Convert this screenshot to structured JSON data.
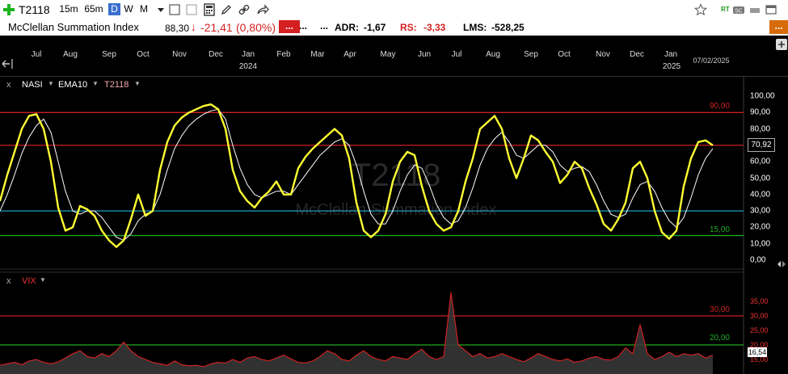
{
  "toolbar": {
    "symbol": "T2118",
    "intervals": [
      "15m",
      "65m",
      "D",
      "W",
      "M"
    ],
    "active_interval": "D",
    "rt_label": "RT",
    "s_label": "S"
  },
  "infobar": {
    "title": "McClellan Summation Index",
    "last": "88,30",
    "change": "-21,41",
    "change_pct": "(0,80%)",
    "dots1": "...",
    "dots2": "...",
    "dots3": "...",
    "adr_label": "ADR:",
    "adr_value": "-1,67",
    "rs_label": "RS:",
    "rs_value": "-3,33",
    "lms_label": "LMS:",
    "lms_value": "-528,25",
    "more_button": "..."
  },
  "timeaxis": {
    "months": [
      "Jul",
      "Aug",
      "Sep",
      "Oct",
      "Nov",
      "Dec",
      "Jan",
      "Feb",
      "Mar",
      "Apr",
      "May",
      "Jun",
      "Jul",
      "Aug",
      "Sep",
      "Oct",
      "Nov",
      "Dec",
      "Jan"
    ],
    "years": [
      "2024",
      "2025"
    ],
    "date_label": "07/02/2025"
  },
  "colors": {
    "main": "#ffff33",
    "ema": "#ffffff",
    "upper": "#cc1f1f",
    "mid": "#1fa0c0",
    "lower": "#22aa22",
    "vix": "#cc2222"
  },
  "chart_data": [
    {
      "type": "line",
      "watermark_symbol": "T2118",
      "watermark_name": "McClellan Summation Index",
      "legend": [
        "NASI",
        "EMA10",
        "T2118"
      ],
      "ylim": [
        0,
        100
      ],
      "yticks": [
        "100,00",
        "90,00",
        "80,00",
        "70,00",
        "60,00",
        "50,00",
        "40,00",
        "30,00",
        "20,00",
        "10,00",
        "0,00"
      ],
      "last_value": "70,92",
      "level_labels": [
        "90,00",
        "15,00"
      ],
      "levels": [
        90,
        70,
        30,
        15
      ],
      "series": [
        {
          "name": "T2118",
          "values": [
            36,
            52,
            66,
            80,
            88,
            89,
            80,
            60,
            32,
            18,
            20,
            33,
            31,
            27,
            18,
            12,
            8,
            12,
            25,
            40,
            27,
            30,
            55,
            72,
            82,
            87,
            90,
            92,
            94,
            95,
            92,
            80,
            55,
            42,
            36,
            32,
            38,
            42,
            48,
            40,
            40,
            56,
            63,
            68,
            72,
            76,
            80,
            76,
            62,
            35,
            18,
            14,
            18,
            28,
            48,
            60,
            66,
            64,
            45,
            30,
            22,
            18,
            20,
            30,
            48,
            62,
            80,
            84,
            88,
            80,
            62,
            50,
            62,
            76,
            73,
            66,
            60,
            47,
            52,
            60,
            56,
            44,
            34,
            22,
            18,
            25,
            35,
            56,
            60,
            50,
            30,
            17,
            13,
            18,
            45,
            62,
            72,
            73,
            70
          ]
        },
        {
          "name": "EMA10",
          "values": [
            30,
            40,
            52,
            65,
            75,
            82,
            86,
            78,
            60,
            42,
            30,
            28,
            30,
            30,
            26,
            20,
            14,
            12,
            16,
            24,
            28,
            30,
            40,
            55,
            68,
            76,
            82,
            86,
            89,
            91,
            92,
            86,
            70,
            56,
            46,
            40,
            38,
            40,
            42,
            42,
            40,
            46,
            52,
            58,
            64,
            68,
            72,
            74,
            70,
            58,
            42,
            28,
            22,
            22,
            30,
            42,
            52,
            58,
            56,
            46,
            34,
            26,
            22,
            24,
            32,
            44,
            58,
            68,
            74,
            78,
            72,
            64,
            62,
            66,
            70,
            70,
            66,
            58,
            54,
            56,
            57,
            54,
            46,
            36,
            28,
            26,
            28,
            38,
            46,
            48,
            42,
            32,
            24,
            20,
            26,
            38,
            52,
            62,
            68
          ]
        }
      ]
    },
    {
      "type": "area",
      "legend": [
        "VIX"
      ],
      "ylim": [
        10,
        40
      ],
      "yticks": [
        "35,00",
        "30,00",
        "25,00",
        "20,00",
        "15,00"
      ],
      "last_value": "16,54",
      "level_labels": [
        "30,00",
        "20,00"
      ],
      "levels": [
        30,
        20
      ],
      "series": [
        {
          "name": "VIX",
          "values": [
            13,
            13.5,
            14,
            13.2,
            14.5,
            15,
            14,
            13.5,
            14.2,
            15.5,
            17,
            18,
            16,
            15.5,
            17,
            16,
            18,
            21,
            18,
            16,
            15,
            14,
            13.5,
            13,
            14.5,
            13.2,
            12.8,
            13,
            12.5,
            13.5,
            14,
            13.8,
            15,
            14,
            15.5,
            16,
            15,
            14.5,
            15.5,
            16.5,
            15.2,
            14,
            13.8,
            14.5,
            16,
            18,
            17,
            15,
            14.5,
            16.5,
            18,
            16,
            15,
            14.5,
            16,
            15.5,
            15,
            17,
            18.5,
            16,
            15,
            16,
            38,
            20,
            18,
            16,
            17,
            15.5,
            16,
            17,
            16,
            15,
            14.2,
            15.5,
            17,
            16,
            15,
            14.5,
            15.2,
            14,
            14.5,
            15.5,
            16,
            15,
            14.8,
            16,
            19,
            17,
            27,
            17,
            15,
            16,
            17.5,
            16,
            17,
            16.5,
            17,
            15.5,
            16.5
          ]
        }
      ]
    }
  ]
}
